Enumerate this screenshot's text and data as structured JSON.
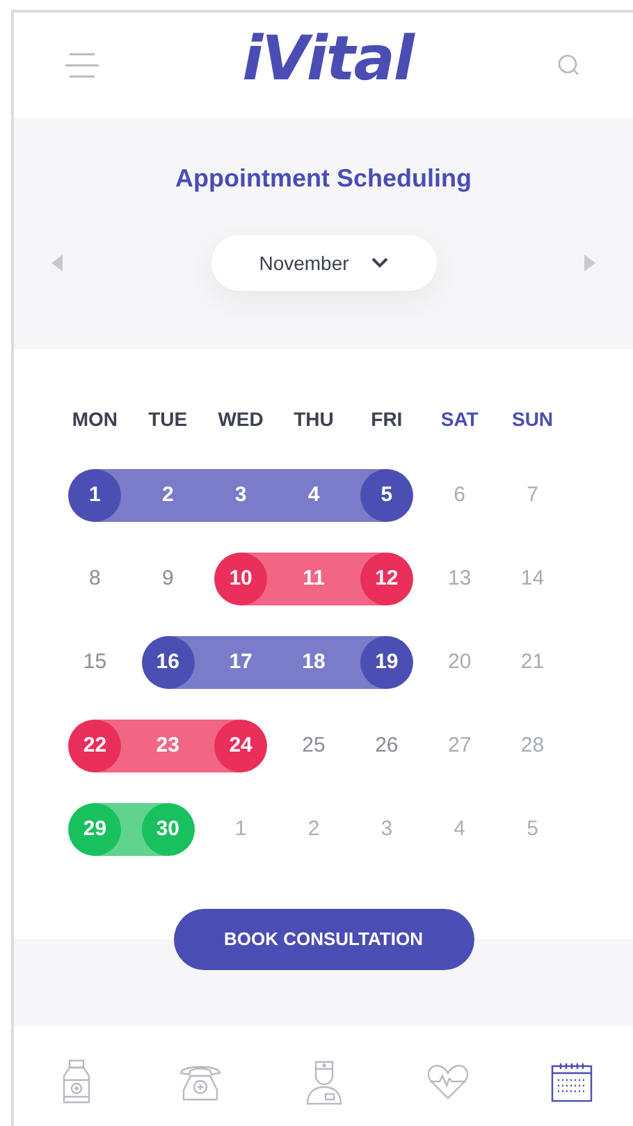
{
  "app": {
    "logo": "iVital"
  },
  "page": {
    "title": "Appointment Scheduling",
    "month": "November"
  },
  "weekdays": [
    {
      "label": "MON",
      "kind": "weekday"
    },
    {
      "label": "TUE",
      "kind": "weekday"
    },
    {
      "label": "WED",
      "kind": "weekday"
    },
    {
      "label": "THU",
      "kind": "weekday"
    },
    {
      "label": "FRI",
      "kind": "weekday"
    },
    {
      "label": "SAT",
      "kind": "weekend"
    },
    {
      "label": "SUN",
      "kind": "weekend"
    }
  ],
  "weeks": [
    [
      {
        "label": "1",
        "kind": "booked-start",
        "color": "#4b4fb3"
      },
      {
        "label": "2",
        "kind": "booked-mid",
        "color": "#7a7cc9"
      },
      {
        "label": "3",
        "kind": "booked-mid",
        "color": "#7a7cc9"
      },
      {
        "label": "4",
        "kind": "booked-mid",
        "color": "#7a7cc9"
      },
      {
        "label": "5",
        "kind": "booked-end",
        "color": "#4b4fb3"
      },
      {
        "label": "6",
        "kind": "weekend"
      },
      {
        "label": "7",
        "kind": "weekend"
      }
    ],
    [
      {
        "label": "8",
        "kind": "weekday"
      },
      {
        "label": "9",
        "kind": "weekday"
      },
      {
        "label": "10",
        "kind": "booked-start",
        "color": "#e92f5a"
      },
      {
        "label": "11",
        "kind": "booked-mid",
        "color": "#f16685"
      },
      {
        "label": "12",
        "kind": "booked-end",
        "color": "#e92f5a"
      },
      {
        "label": "13",
        "kind": "weekend"
      },
      {
        "label": "14",
        "kind": "weekend"
      }
    ],
    [
      {
        "label": "15",
        "kind": "weekday"
      },
      {
        "label": "16",
        "kind": "booked-start",
        "color": "#4b4fb3"
      },
      {
        "label": "17",
        "kind": "booked-mid",
        "color": "#7a7cc9"
      },
      {
        "label": "18",
        "kind": "booked-mid",
        "color": "#7a7cc9"
      },
      {
        "label": "19",
        "kind": "booked-end",
        "color": "#4b4fb3"
      },
      {
        "label": "20",
        "kind": "weekend"
      },
      {
        "label": "21",
        "kind": "weekend"
      }
    ],
    [
      {
        "label": "22",
        "kind": "booked-start",
        "color": "#e92f5a"
      },
      {
        "label": "23",
        "kind": "booked-mid",
        "color": "#f16685"
      },
      {
        "label": "24",
        "kind": "booked-end",
        "color": "#e92f5a"
      },
      {
        "label": "25",
        "kind": "weekday"
      },
      {
        "label": "26",
        "kind": "weekday"
      },
      {
        "label": "27",
        "kind": "weekend"
      },
      {
        "label": "28",
        "kind": "weekend"
      }
    ],
    [
      {
        "label": "29",
        "kind": "booked-start",
        "color": "#18c15d"
      },
      {
        "label": "30",
        "kind": "booked-end",
        "color": "#18c15d"
      },
      {
        "label": "1",
        "kind": "other-month"
      },
      {
        "label": "2",
        "kind": "other-month"
      },
      {
        "label": "3",
        "kind": "other-month"
      },
      {
        "label": "4",
        "kind": "other-month"
      },
      {
        "label": "5",
        "kind": "other-month"
      }
    ]
  ],
  "button": "BOOK CONSULTATION",
  "nav": [
    {
      "kind": "bottle",
      "selected": false
    },
    {
      "kind": "phone",
      "selected": false
    },
    {
      "kind": "doctor",
      "selected": false
    },
    {
      "kind": "heart",
      "selected": false
    },
    {
      "kind": "calendar",
      "selected": true
    }
  ]
}
